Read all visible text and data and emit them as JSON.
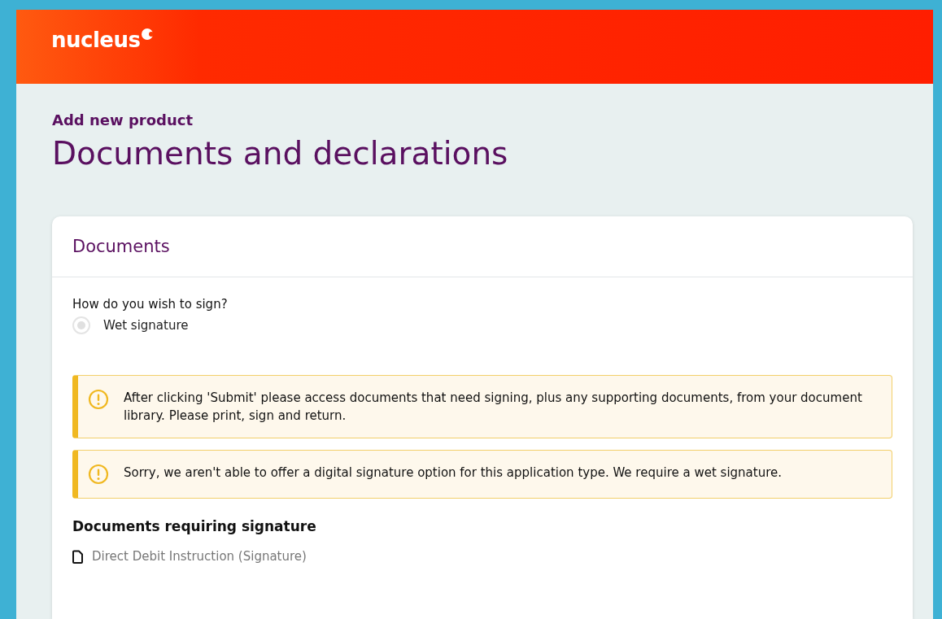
{
  "header": {
    "logo": "nucleus"
  },
  "page": {
    "subtitle": "Add new product",
    "title": "Documents and declarations"
  },
  "card": {
    "title": "Documents",
    "question": "How do you wish to sign?",
    "options": [
      {
        "label": "Wet signature",
        "selected": true,
        "disabled": true
      }
    ],
    "alerts": [
      {
        "kind": "warning",
        "text": "After clicking 'Submit' please access documents that need signing, plus any supporting documents, from your document library. Please print, sign and return."
      },
      {
        "kind": "warning",
        "text": "Sorry, we aren't able to offer a digital signature option for this application type. We require a wet signature."
      }
    ],
    "section_title": "Documents requiring signature",
    "documents": [
      {
        "name": "Direct Debit Instruction (Signature)"
      }
    ]
  }
}
